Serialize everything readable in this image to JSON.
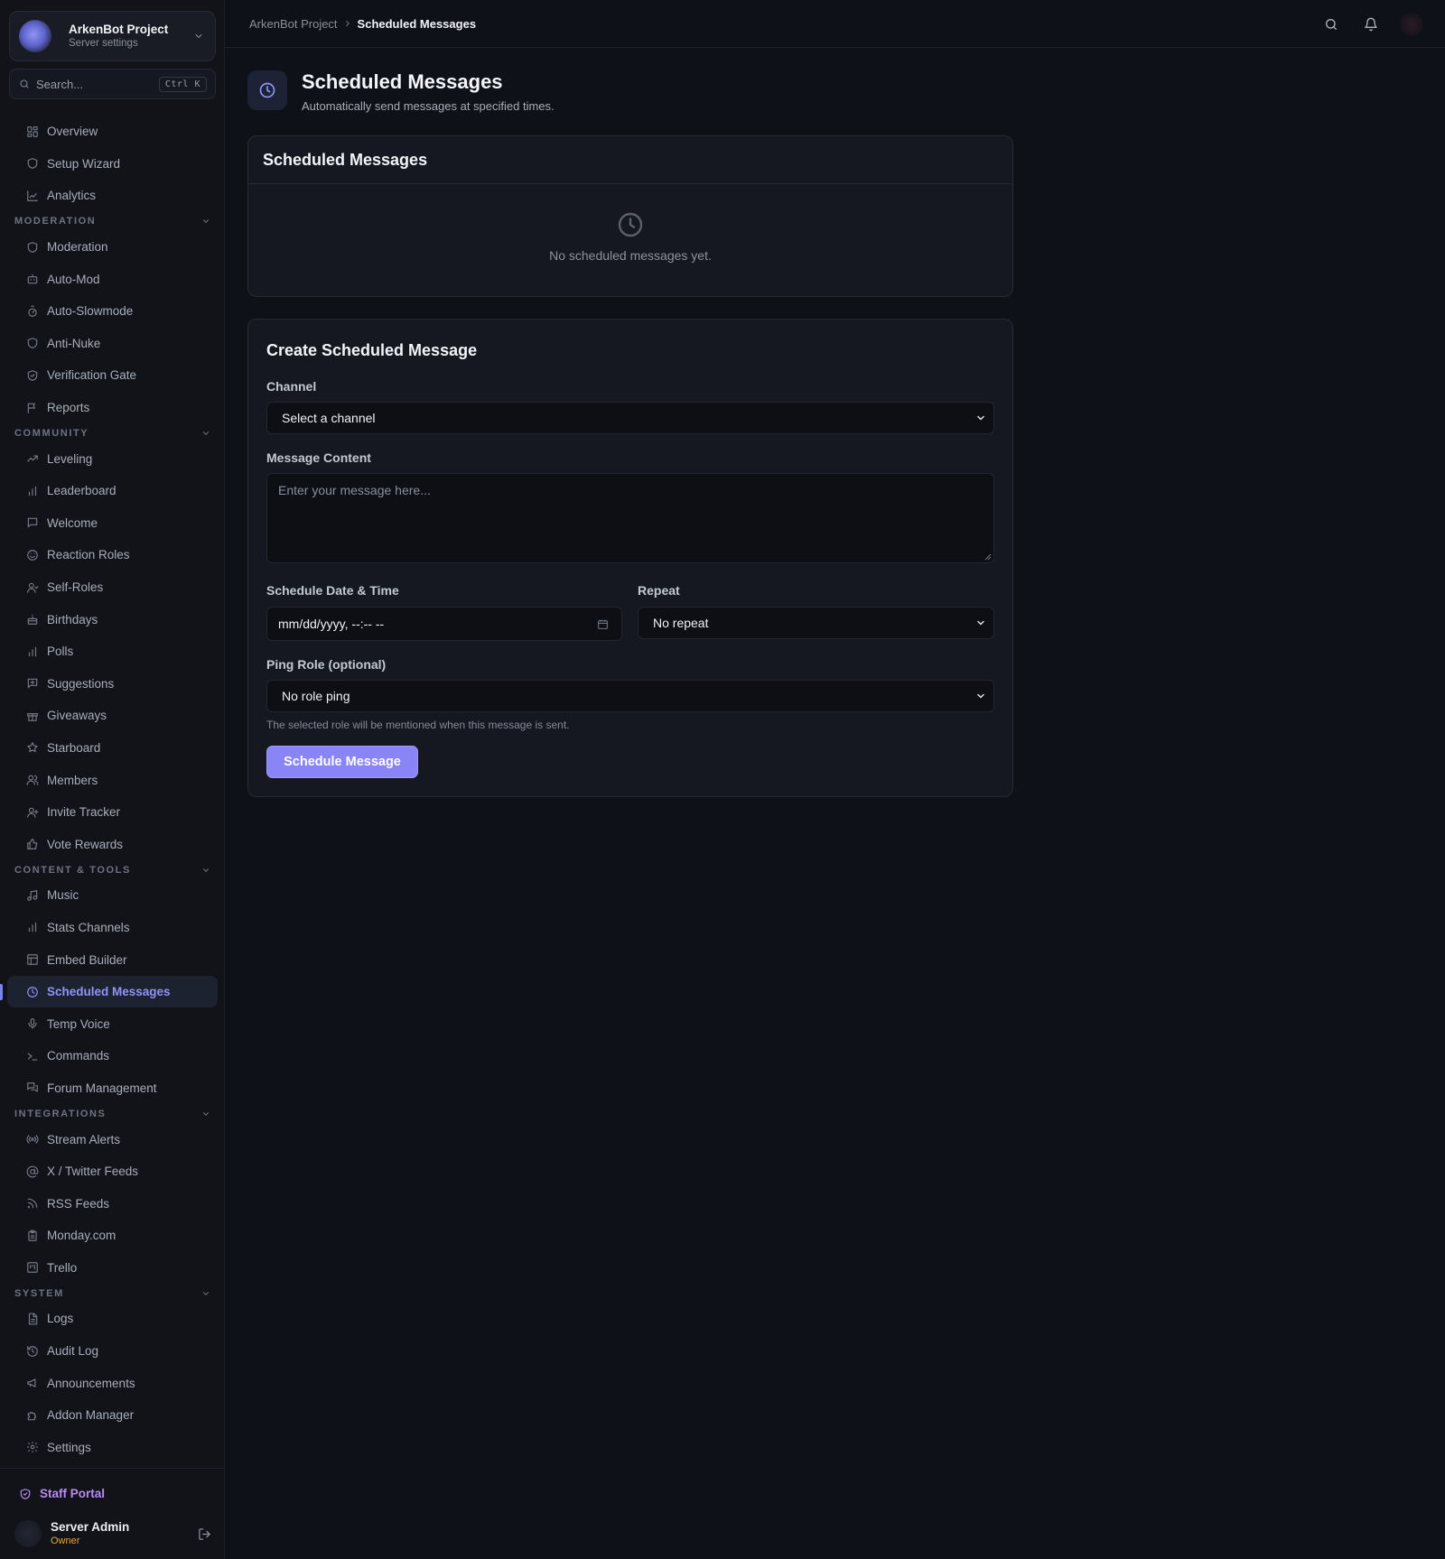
{
  "server": {
    "name": "ArkenBot Project",
    "subtitle": "Server settings"
  },
  "search": {
    "placeholder": "Search...",
    "shortcut": "Ctrl K"
  },
  "nav": {
    "top": [
      {
        "label": "Overview",
        "icon": "grid-icon"
      },
      {
        "label": "Setup Wizard",
        "icon": "shield-icon"
      },
      {
        "label": "Analytics",
        "icon": "chart-line-icon"
      }
    ],
    "moderation": {
      "title": "MODERATION",
      "items": [
        {
          "label": "Moderation",
          "icon": "shield-icon"
        },
        {
          "label": "Auto-Mod",
          "icon": "bot-icon"
        },
        {
          "label": "Auto-Slowmode",
          "icon": "timer-icon"
        },
        {
          "label": "Anti-Nuke",
          "icon": "shield-icon"
        },
        {
          "label": "Verification Gate",
          "icon": "shield-check-icon"
        },
        {
          "label": "Reports",
          "icon": "flag-icon"
        }
      ]
    },
    "community": {
      "title": "COMMUNITY",
      "items": [
        {
          "label": "Leveling",
          "icon": "trending-up-icon"
        },
        {
          "label": "Leaderboard",
          "icon": "bar-chart-icon"
        },
        {
          "label": "Welcome",
          "icon": "message-icon"
        },
        {
          "label": "Reaction Roles",
          "icon": "smile-icon"
        },
        {
          "label": "Self-Roles",
          "icon": "user-icon"
        },
        {
          "label": "Birthdays",
          "icon": "cake-icon"
        },
        {
          "label": "Polls",
          "icon": "bar-chart-icon"
        },
        {
          "label": "Suggestions",
          "icon": "message-plus-icon"
        },
        {
          "label": "Giveaways",
          "icon": "gift-icon"
        },
        {
          "label": "Starboard",
          "icon": "star-icon"
        },
        {
          "label": "Members",
          "icon": "users-icon"
        },
        {
          "label": "Invite Tracker",
          "icon": "user-plus-icon"
        },
        {
          "label": "Vote Rewards",
          "icon": "thumbs-up-icon"
        }
      ]
    },
    "content_tools": {
      "title": "CONTENT & TOOLS",
      "items": [
        {
          "label": "Music",
          "icon": "music-icon"
        },
        {
          "label": "Stats Channels",
          "icon": "bar-chart-icon"
        },
        {
          "label": "Embed Builder",
          "icon": "layout-icon"
        },
        {
          "label": "Scheduled Messages",
          "icon": "clock-icon",
          "active": true
        },
        {
          "label": "Temp Voice",
          "icon": "mic-icon"
        },
        {
          "label": "Commands",
          "icon": "terminal-icon"
        },
        {
          "label": "Forum Management",
          "icon": "messages-icon"
        }
      ]
    },
    "integrations": {
      "title": "INTEGRATIONS",
      "items": [
        {
          "label": "Stream Alerts",
          "icon": "radio-icon"
        },
        {
          "label": "X / Twitter Feeds",
          "icon": "at-sign-icon"
        },
        {
          "label": "RSS Feeds",
          "icon": "rss-icon"
        },
        {
          "label": "Monday.com",
          "icon": "clipboard-icon"
        },
        {
          "label": "Trello",
          "icon": "kanban-icon"
        }
      ]
    },
    "system": {
      "title": "SYSTEM",
      "items": [
        {
          "label": "Logs",
          "icon": "file-text-icon"
        },
        {
          "label": "Audit Log",
          "icon": "history-icon"
        },
        {
          "label": "Announcements",
          "icon": "megaphone-icon"
        },
        {
          "label": "Addon Manager",
          "icon": "puzzle-icon"
        },
        {
          "label": "Settings",
          "icon": "gear-icon"
        }
      ]
    }
  },
  "staff_portal": {
    "label": "Staff Portal"
  },
  "user": {
    "name": "Server Admin",
    "role": "Owner"
  },
  "breadcrumb": {
    "root": "ArkenBot Project",
    "current": "Scheduled Messages"
  },
  "page": {
    "title": "Scheduled Messages",
    "subtitle": "Automatically send messages at specified times."
  },
  "list_card": {
    "title": "Scheduled Messages",
    "empty_text": "No scheduled messages yet."
  },
  "form": {
    "title": "Create Scheduled Message",
    "channel": {
      "label": "Channel",
      "value": "Select a channel"
    },
    "content": {
      "label": "Message Content",
      "placeholder": "Enter your message here..."
    },
    "datetime": {
      "label": "Schedule Date & Time",
      "value": "mm/dd/yyyy, --:-- --"
    },
    "repeat": {
      "label": "Repeat",
      "value": "No repeat"
    },
    "ping_role": {
      "label": "Ping Role (optional)",
      "value": "No role ping",
      "hint": "The selected role will be mentioned when this message is sent."
    },
    "submit_label": "Schedule Message"
  },
  "colors": {
    "accent": "#8a85f7",
    "active_nav": "#8e95f8",
    "staff": "#b88bf5",
    "owner_badge": "#e3a93b"
  }
}
